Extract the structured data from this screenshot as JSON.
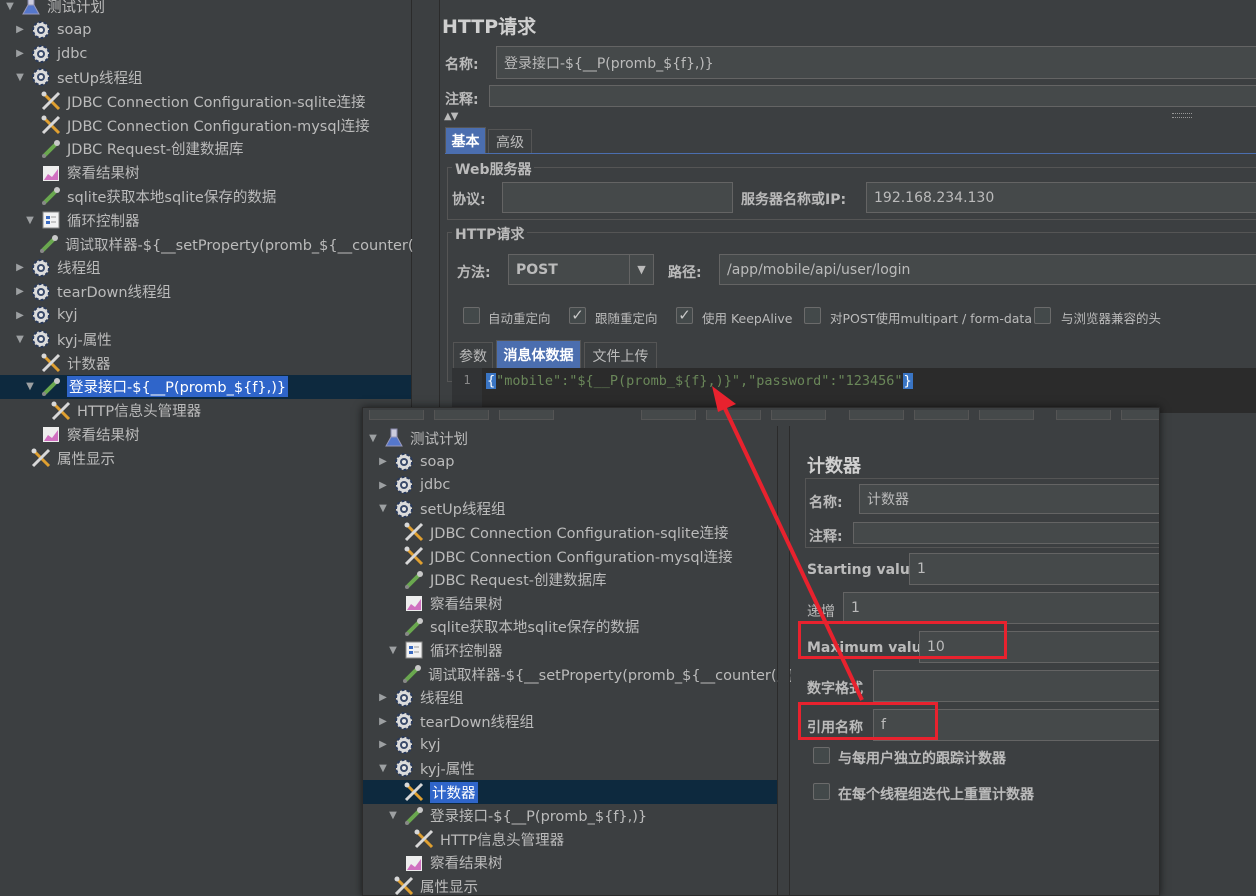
{
  "bg_tree": {
    "items": [
      {
        "label": "测试计划",
        "icon": "flask-icon",
        "arrow": "down"
      },
      {
        "label": "soap",
        "icon": "gear-icon",
        "arrow": "right"
      },
      {
        "label": "jdbc",
        "icon": "gear-icon",
        "arrow": "right"
      },
      {
        "label": "setUp线程组",
        "icon": "gear-icon",
        "arrow": "down"
      },
      {
        "label": "JDBC Connection Configuration-sqlite连接",
        "icon": "wrench-icon",
        "arrow": ""
      },
      {
        "label": "JDBC Connection Configuration-mysql连接",
        "icon": "wrench-icon",
        "arrow": ""
      },
      {
        "label": "JDBC Request-创建数据库",
        "icon": "sampler-icon",
        "arrow": ""
      },
      {
        "label": "察看结果树",
        "icon": "chart-icon",
        "arrow": ""
      },
      {
        "label": "sqlite获取本地sqlite保存的数据",
        "icon": "sampler-icon",
        "arrow": ""
      },
      {
        "label": "循环控制器",
        "icon": "controller-icon",
        "arrow": "down"
      },
      {
        "label": "调试取样器-${__setProperty(promb_${__counter(,)}",
        "icon": "sampler-icon",
        "arrow": ""
      },
      {
        "label": "线程组",
        "icon": "gear-icon",
        "arrow": "right"
      },
      {
        "label": "tearDown线程组",
        "icon": "gear-icon",
        "arrow": "right"
      },
      {
        "label": "kyj",
        "icon": "gear-icon",
        "arrow": "right"
      },
      {
        "label": "kyj-属性",
        "icon": "gear-icon",
        "arrow": "down"
      },
      {
        "label": "计数器",
        "icon": "wrench-icon",
        "arrow": ""
      },
      {
        "label": "登录接口-${__P(promb_${f},)}",
        "icon": "sampler-icon",
        "arrow": "down"
      },
      {
        "label": "HTTP信息头管理器",
        "icon": "wrench-icon",
        "arrow": ""
      },
      {
        "label": "察看结果树",
        "icon": "chart-icon",
        "arrow": ""
      },
      {
        "label": "属性显示",
        "icon": "wrench-icon",
        "arrow": ""
      }
    ]
  },
  "http_panel": {
    "title": "HTTP请求",
    "name_label": "名称:",
    "name_value": "登录接口-${__P(promb_${f},)}",
    "comment_label": "注释:",
    "tabs": [
      "基本",
      "高级"
    ],
    "web_server_title": "Web服务器",
    "protocol_label": "协议:",
    "protocol_value": "",
    "server_label": "服务器名称或IP:",
    "server_value": "192.168.234.130",
    "http_request_title": "HTTP请求",
    "method_label": "方法:",
    "method_value": "POST",
    "path_label": "路径:",
    "path_value": "/app/mobile/api/user/login",
    "checkboxes": [
      {
        "label": "自动重定向",
        "checked": false
      },
      {
        "label": "跟随重定向",
        "checked": true
      },
      {
        "label": "使用 KeepAlive",
        "checked": true
      },
      {
        "label": "对POST使用multipart / form-data",
        "checked": false
      },
      {
        "label": "与浏览器兼容的头",
        "checked": false
      }
    ],
    "body_tabs": [
      "参数",
      "消息体数据",
      "文件上传"
    ],
    "code": {
      "line_number": "1",
      "open_brace": "{",
      "segment1": "\"mobile\":\"${__P(promb_${f},)}\",\"password\":\"123456\"",
      "close_brace": "}"
    }
  },
  "overlay": {
    "tree_items": [
      {
        "label": "测试计划",
        "icon": "flask-icon",
        "arrow": "down"
      },
      {
        "label": "soap",
        "icon": "gear-icon",
        "arrow": "right"
      },
      {
        "label": "jdbc",
        "icon": "gear-icon",
        "arrow": "right"
      },
      {
        "label": "setUp线程组",
        "icon": "gear-icon",
        "arrow": "down"
      },
      {
        "label": "JDBC Connection Configuration-sqlite连接",
        "icon": "wrench-icon",
        "arrow": ""
      },
      {
        "label": "JDBC Connection Configuration-mysql连接",
        "icon": "wrench-icon",
        "arrow": ""
      },
      {
        "label": "JDBC Request-创建数据库",
        "icon": "sampler-icon",
        "arrow": ""
      },
      {
        "label": "察看结果树",
        "icon": "chart-icon",
        "arrow": ""
      },
      {
        "label": "sqlite获取本地sqlite保存的数据",
        "icon": "sampler-icon",
        "arrow": ""
      },
      {
        "label": "循环控制器",
        "icon": "controller-icon",
        "arrow": "down"
      },
      {
        "label": "调试取样器-${__setProperty(promb_${__counter(,)}",
        "icon": "sampler-icon",
        "arrow": ""
      },
      {
        "label": "线程组",
        "icon": "gear-icon",
        "arrow": "right"
      },
      {
        "label": "tearDown线程组",
        "icon": "gear-icon",
        "arrow": "right"
      },
      {
        "label": "kyj",
        "icon": "gear-icon",
        "arrow": "right"
      },
      {
        "label": "kyj-属性",
        "icon": "gear-icon",
        "arrow": "down"
      },
      {
        "label": "计数器",
        "icon": "wrench-icon",
        "arrow": ""
      },
      {
        "label": "登录接口-${__P(promb_${f},)}",
        "icon": "sampler-icon",
        "arrow": "down"
      },
      {
        "label": "HTTP信息头管理器",
        "icon": "wrench-icon",
        "arrow": ""
      },
      {
        "label": "察看结果树",
        "icon": "chart-icon",
        "arrow": ""
      },
      {
        "label": "属性显示",
        "icon": "wrench-icon",
        "arrow": ""
      }
    ],
    "counter": {
      "title": "计数器",
      "name_label": "名称:",
      "name_value": "计数器",
      "comment_label": "注释:",
      "start_label": "Starting value",
      "start_value": "1",
      "increment_label": "递增",
      "increment_value": "1",
      "max_label": "Maximum value",
      "max_value": "10",
      "format_label": "数字格式",
      "format_value": "",
      "ref_label": "引用名称",
      "ref_value": "f",
      "per_user_label": "与每用户独立的跟踪计数器",
      "reset_label": "在每个线程组迭代上重置计数器"
    }
  },
  "colors": {
    "background": "#3c3f41",
    "selection": "#2f65ca",
    "active_tab": "#4b6eaf",
    "annotation_red": "#e8222e"
  }
}
